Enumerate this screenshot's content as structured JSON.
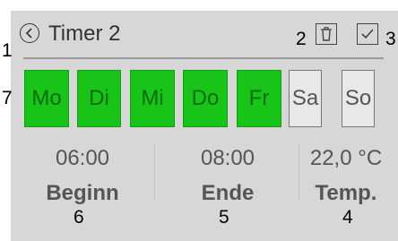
{
  "header": {
    "title": "Timer 2"
  },
  "days": [
    {
      "label": "Mo",
      "active": true
    },
    {
      "label": "Di",
      "active": true
    },
    {
      "label": "Mi",
      "active": true
    },
    {
      "label": "Do",
      "active": true
    },
    {
      "label": "Fr",
      "active": true
    },
    {
      "label": "Sa",
      "active": false
    },
    {
      "label": "So",
      "active": false
    }
  ],
  "fields": {
    "start": {
      "value": "06:00",
      "label": "Beginn"
    },
    "end": {
      "value": "08:00",
      "label": "Ende"
    },
    "temp": {
      "value": "22,0 °C",
      "label": "Temp."
    }
  },
  "annotations": {
    "a1": "1",
    "a2": "2",
    "a3": "3",
    "a4": "4",
    "a5": "5",
    "a6": "6",
    "a7": "7"
  },
  "colors": {
    "active_day": "#17c417",
    "screen_bg": "#d7d7d7"
  }
}
